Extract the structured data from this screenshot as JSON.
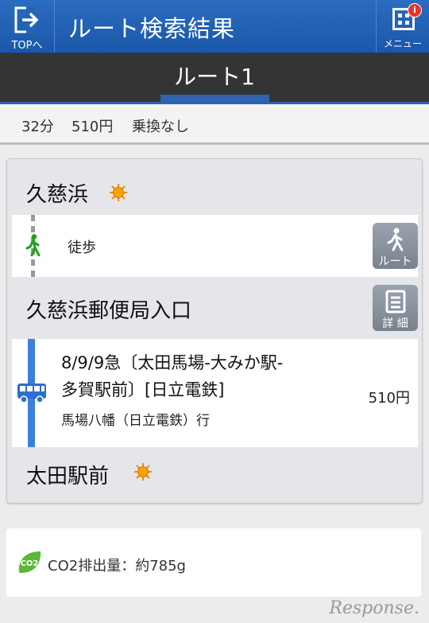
{
  "header": {
    "top_label": "TOPへ",
    "title": "ルート検索結果",
    "menu_label": "メニュー",
    "menu_badge": "i"
  },
  "tabs": {
    "active_label": "ルート1"
  },
  "summary": {
    "time": "32分",
    "fare": "510円",
    "transfer": "乗換なし"
  },
  "route": {
    "start_station": "久慈浜",
    "walk_label": "徒歩",
    "route_button_label": "ルート",
    "transfer_station": "久慈浜郵便局入口",
    "detail_button_label": "詳 細",
    "bus_line1": "8/9/9急〔太田馬場-大みか駅-",
    "bus_line2": "多賀駅前〕[日立電鉄]",
    "bus_destination": "馬場八幡（日立電鉄）行",
    "bus_fare": "510円",
    "end_station": "太田駅前"
  },
  "co2": {
    "icon_text": "CO2",
    "text": "CO2排出量：約785g"
  },
  "watermark": "Response."
}
